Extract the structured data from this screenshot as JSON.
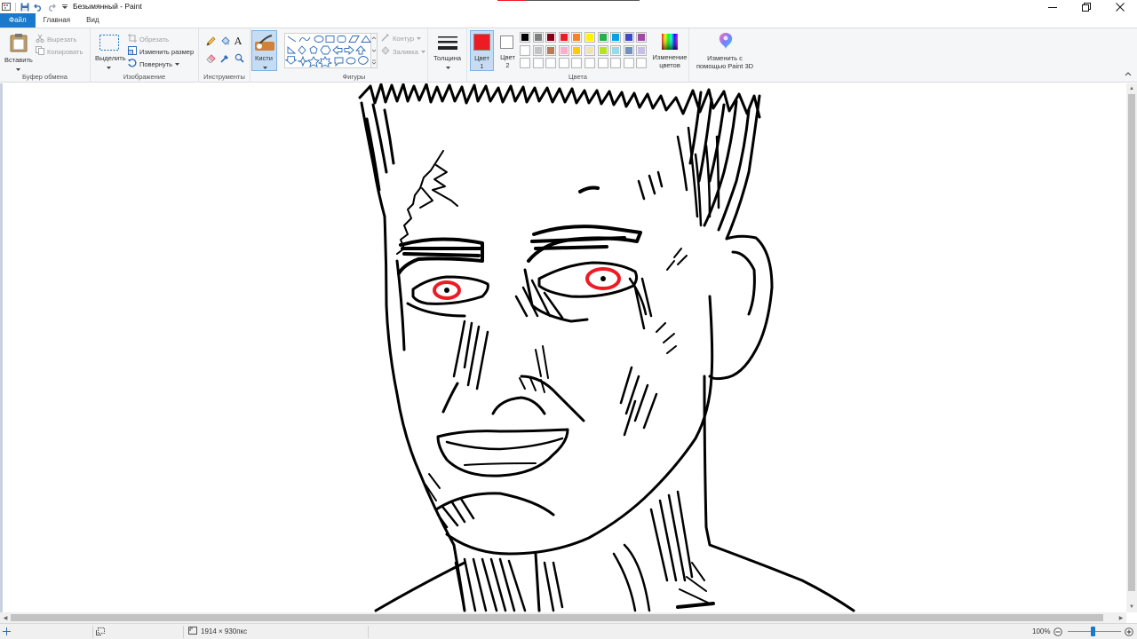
{
  "window": {
    "title": "Безымянный - Paint",
    "controls": {
      "minimize": "minimize-icon",
      "maximize": "restore-icon",
      "close": "close-icon"
    }
  },
  "quick_access": [
    "save-icon",
    "undo-icon",
    "redo-icon",
    "customize-qat-icon"
  ],
  "tabs": [
    {
      "label": "Файл",
      "active": true
    },
    {
      "label": "Главная",
      "active": false
    },
    {
      "label": "Вид",
      "active": false
    }
  ],
  "ribbon": {
    "clipboard": {
      "group_label": "Буфер обмена",
      "paste": "Вставить",
      "cut": "Вырезать",
      "copy": "Копировать"
    },
    "image": {
      "group_label": "Изображение",
      "select": "Выделить",
      "crop": "Обрезать",
      "resize": "Изменить размер",
      "rotate": "Повернуть"
    },
    "tools": {
      "group_label": "Инструменты",
      "text_tool": "A",
      "brushes": "Кисти"
    },
    "shapes": {
      "group_label": "Фигуры",
      "outline": "Контур",
      "fill": "Заливка"
    },
    "size": {
      "label": "Толщина"
    },
    "colors": {
      "group_label": "Цвета",
      "color1_label": "Цвет",
      "color1_num": "1",
      "color1_value": "#ed1c24",
      "color2_label": "Цвет",
      "color2_num": "2",
      "color2_value": "#ffffff",
      "edit_colors_line1": "Изменение",
      "edit_colors_line2": "цветов",
      "palette_row1": [
        "#000000",
        "#7f7f7f",
        "#880015",
        "#ed1c24",
        "#ff7f27",
        "#fff200",
        "#22b14c",
        "#00a2e8",
        "#3f48cc",
        "#a349a4"
      ],
      "palette_row2": [
        "#ffffff",
        "#c3c3c3",
        "#b97a57",
        "#ffaec9",
        "#ffc90e",
        "#efe4b0",
        "#b5e61d",
        "#99d9ea",
        "#7092be",
        "#c8bfe7"
      ],
      "palette_row3": [
        "#ffffff",
        "#ffffff",
        "#ffffff",
        "#ffffff",
        "#ffffff",
        "#ffffff",
        "#ffffff",
        "#ffffff",
        "#ffffff",
        "#ffffff"
      ]
    },
    "paint3d": {
      "line1": "Изменить с",
      "line2": "помощью Paint 3D"
    }
  },
  "canvas": {
    "drawing": "sketch-of-face",
    "ink_color": "#000000",
    "eye_color": "#ed1c24"
  },
  "status": {
    "image_size": "1914 × 930пкс",
    "zoom": "100%"
  }
}
